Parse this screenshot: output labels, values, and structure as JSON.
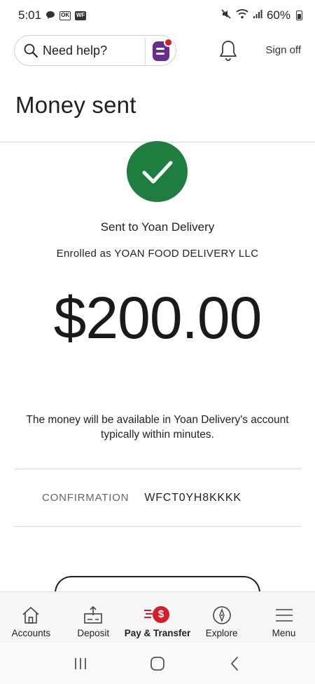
{
  "status_bar": {
    "time": "5:01",
    "notif_icons": [
      "chat-bubble-icon",
      "ok-box-icon",
      "wf-box-icon"
    ],
    "badge_ok": "OK",
    "badge_wf": "WF",
    "battery_text": "60%",
    "right_icons": [
      "mute-icon",
      "wifi-icon",
      "signal-icon",
      "battery-icon"
    ]
  },
  "header": {
    "search_label": "Need help?",
    "sign_off": "Sign off",
    "colors": {
      "assistant_purple": "#6b2c91",
      "alert_red": "#d71e28"
    }
  },
  "page": {
    "title": "Money sent"
  },
  "result": {
    "status_icon": "checkmark-icon",
    "status_color": "#1e7e3f",
    "sent_to": "Sent to Yoan Delivery",
    "enrolled_as": "Enrolled as YOAN FOOD DELIVERY LLC",
    "amount": "$200.00",
    "availability_line1": "The money will be available in Yoan Delivery's account",
    "availability_line2": "typically within minutes."
  },
  "confirmation": {
    "label": "CONFIRMATION",
    "value": "WFCT0YH8KKKK"
  },
  "bottom_nav": {
    "items": [
      {
        "label": "Accounts",
        "icon": "house-icon",
        "active": false
      },
      {
        "label": "Deposit",
        "icon": "deposit-icon",
        "active": false
      },
      {
        "label": "Pay & Transfer",
        "icon": "pay-transfer-icon",
        "active": true
      },
      {
        "label": "Explore",
        "icon": "compass-icon",
        "active": false
      },
      {
        "label": "Menu",
        "icon": "hamburger-icon",
        "active": false
      }
    ],
    "pay_symbol": "$",
    "active_color": "#d71e28"
  },
  "system_nav": {
    "buttons": [
      "recents-icon",
      "home-icon",
      "back-icon"
    ]
  }
}
